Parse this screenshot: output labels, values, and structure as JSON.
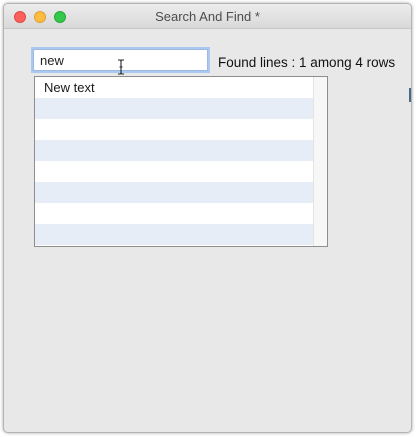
{
  "window": {
    "title": "Search And Find *"
  },
  "search": {
    "value": "new"
  },
  "status": {
    "text": "Found lines : 1 among 4 rows"
  },
  "results": {
    "rows": [
      "New text",
      "",
      "",
      "",
      "",
      "",
      "",
      ""
    ]
  },
  "colors": {
    "row_stripe": "#e7edf6",
    "focus_ring": "#a9c9f1",
    "close": "#fc605c",
    "minimize": "#fdbc40",
    "zoom": "#34c84a"
  },
  "icons": {
    "cursor": "text-cursor-icon"
  }
}
